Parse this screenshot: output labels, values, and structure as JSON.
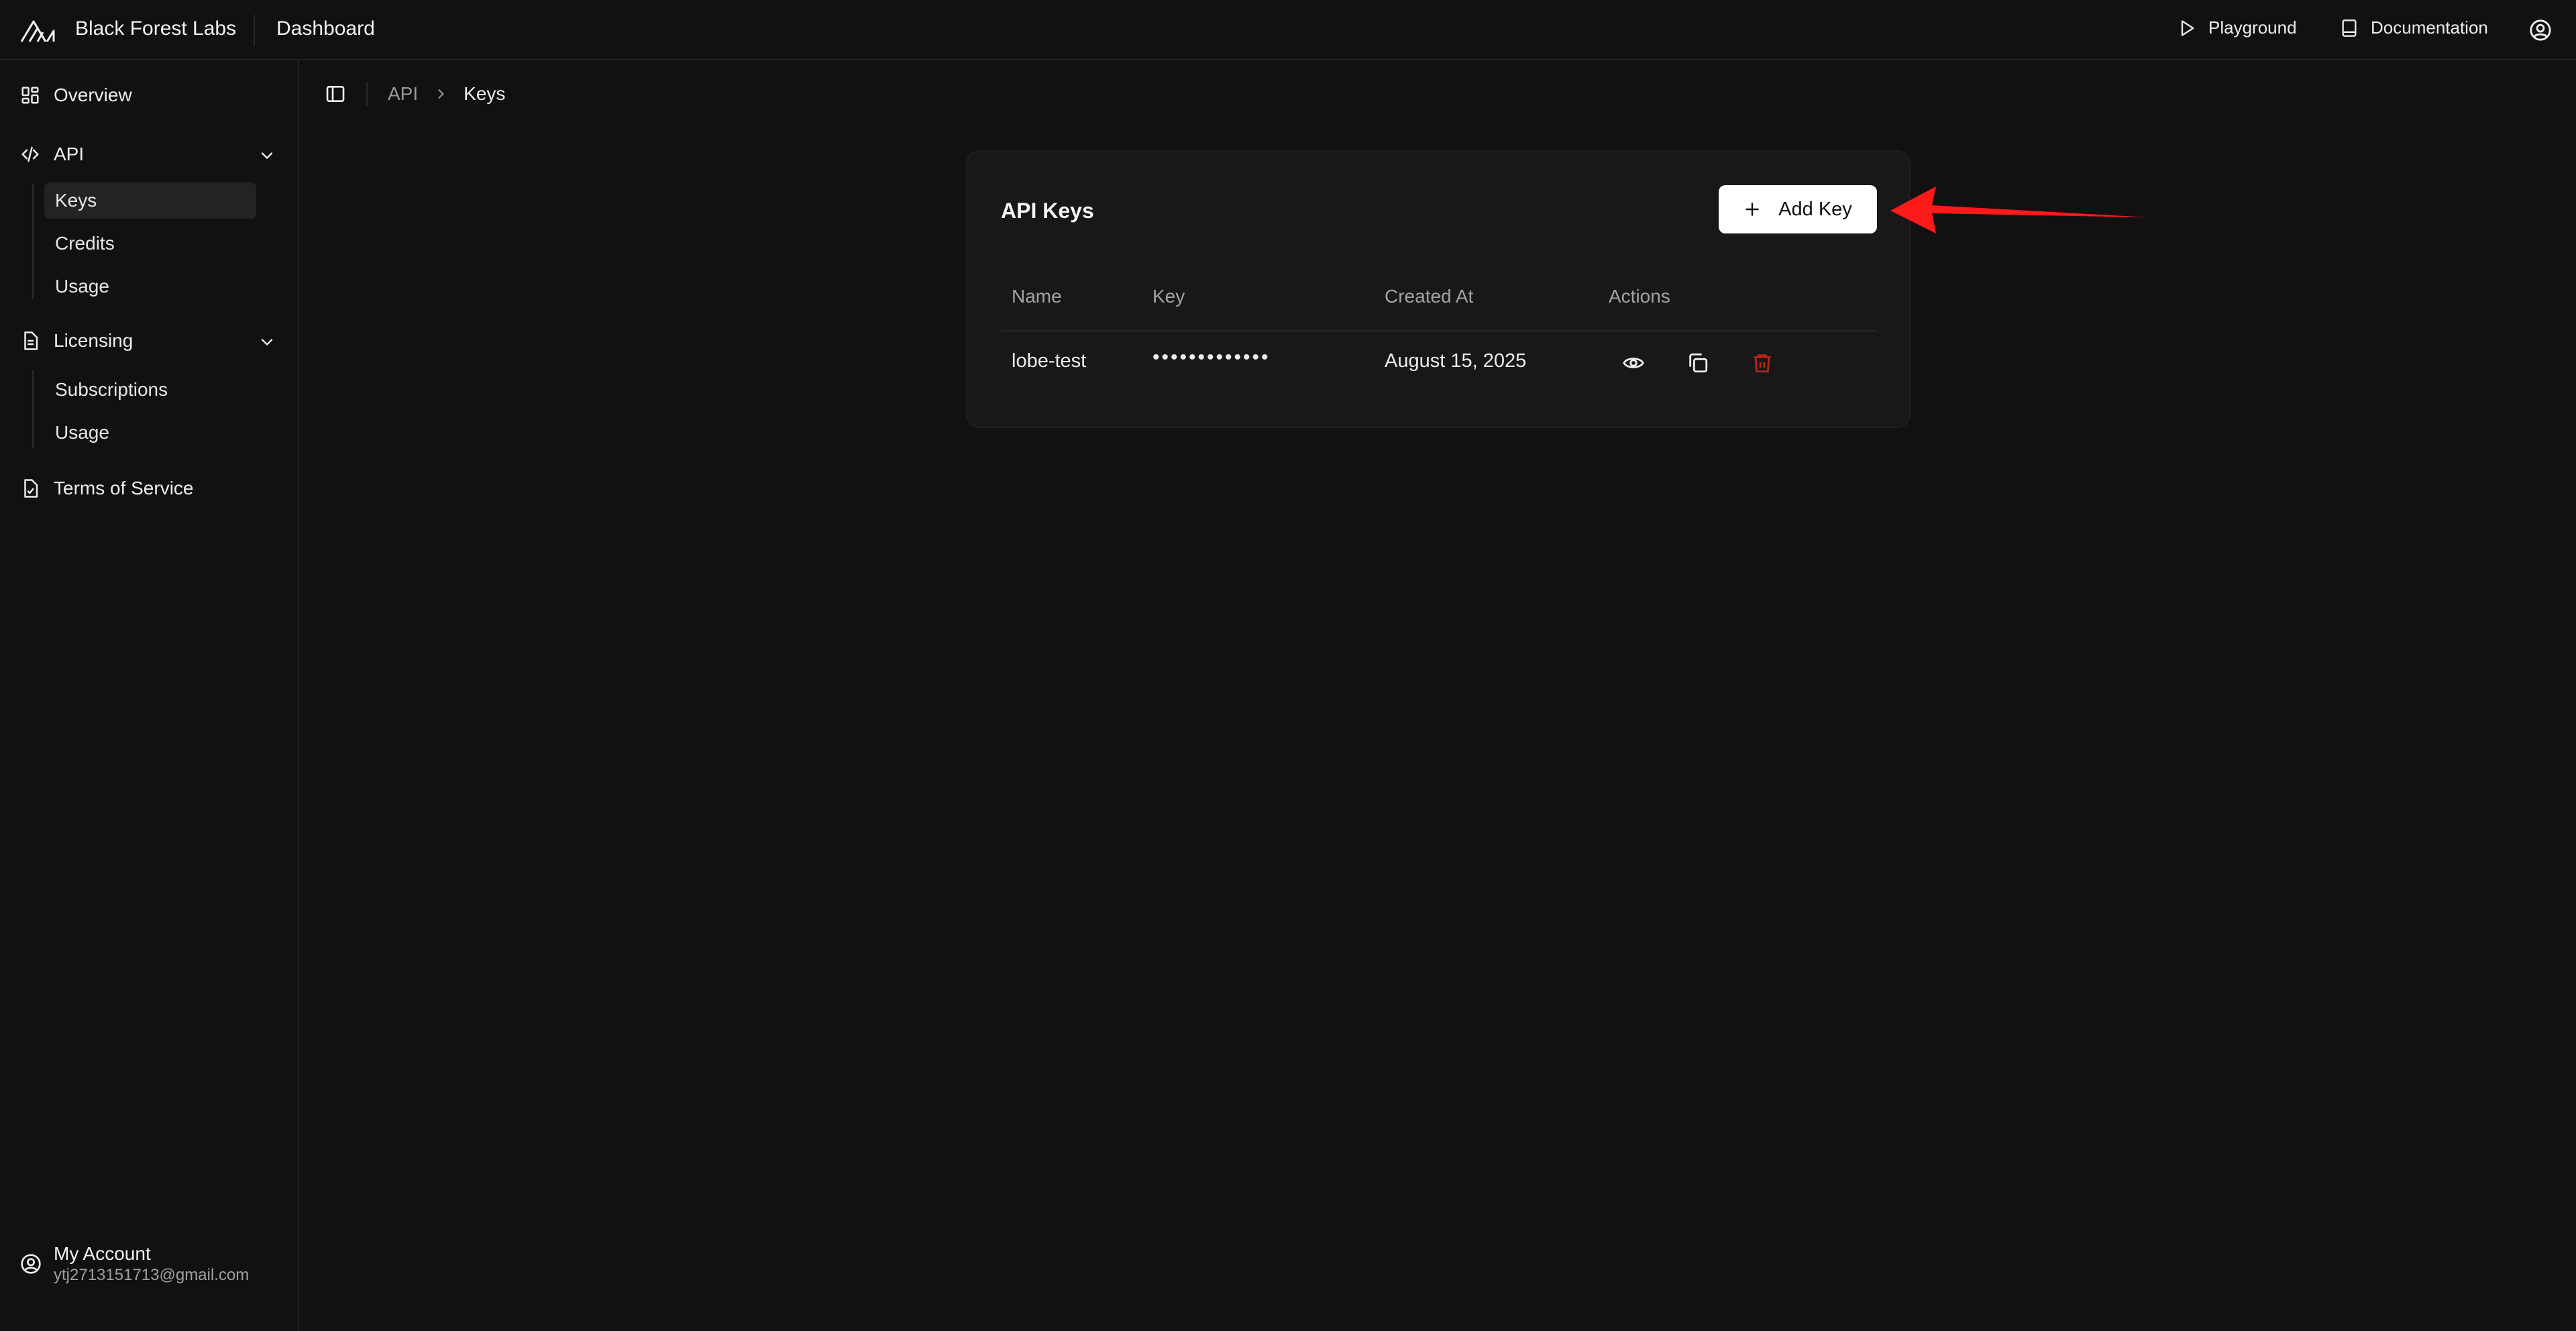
{
  "topbar": {
    "brand": "Black Forest Labs",
    "section": "Dashboard",
    "links": {
      "playground": "Playground",
      "documentation": "Documentation"
    }
  },
  "sidebar": {
    "overview": "Overview",
    "api": {
      "label": "API",
      "items": [
        "Keys",
        "Credits",
        "Usage"
      ]
    },
    "licensing": {
      "label": "Licensing",
      "items": [
        "Subscriptions",
        "Usage"
      ]
    },
    "terms": "Terms of Service",
    "account": {
      "name": "My Account",
      "email": "ytj2713151713@gmail.com"
    }
  },
  "breadcrumb": {
    "parent": "API",
    "current": "Keys"
  },
  "card": {
    "title": "API Keys",
    "add_button": "Add Key",
    "columns": [
      "Name",
      "Key",
      "Created At",
      "Actions"
    ],
    "rows": [
      {
        "name": "lobe-test",
        "key": "•••••••••••••",
        "created_at": "August 15, 2025"
      }
    ]
  },
  "colors": {
    "background": "#111111",
    "card": "#181818",
    "accent_delete": "#b3261e",
    "annotation_arrow": "#ff1a1a"
  },
  "icons": [
    "logo-icon",
    "play-icon",
    "book-icon",
    "user-circle-icon",
    "grid-icon",
    "code-icon",
    "chevron-down-icon",
    "document-icon",
    "document-check-icon",
    "sidebar-toggle-icon",
    "chevron-right-icon",
    "plus-icon",
    "eye-icon",
    "copy-icon",
    "trash-icon"
  ]
}
